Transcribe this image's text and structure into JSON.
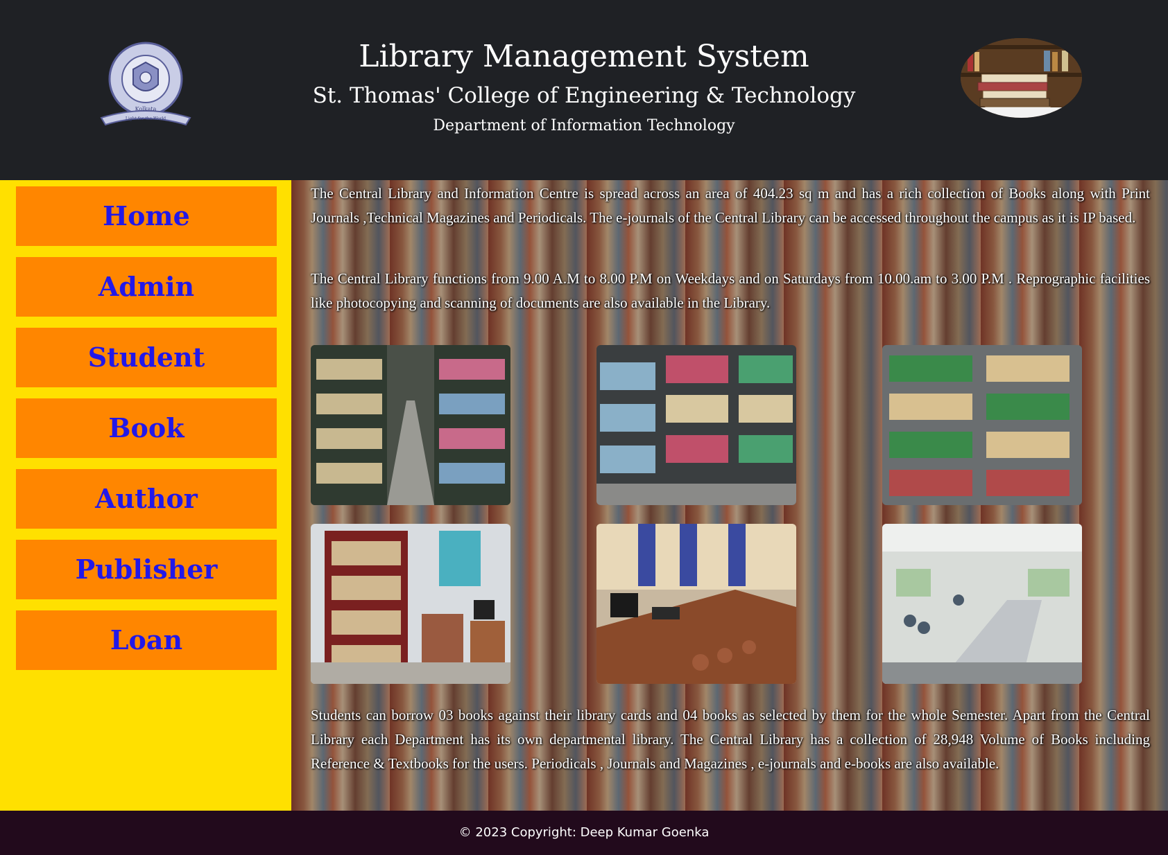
{
  "header": {
    "title": "Library Management System",
    "college": "St. Thomas' College of Engineering & Technology",
    "department": "Department of Information Technology",
    "logo_left_icon": "college-seal-icon",
    "logo_right_icon": "stacked-books-icon",
    "logo_seal_text": {
      "ring": "St. Thomas' College of Engineering & Technology",
      "city": "Kolkata",
      "motto": "Light for the World"
    }
  },
  "sidebar": {
    "items": [
      {
        "label": "Home"
      },
      {
        "label": "Admin"
      },
      {
        "label": "Student"
      },
      {
        "label": "Book"
      },
      {
        "label": "Author"
      },
      {
        "label": "Publisher"
      },
      {
        "label": "Loan"
      }
    ]
  },
  "main": {
    "paragraphs": [
      "The Central Library and Information Centre is spread across an area of 404.23 sq m and has a rich collection of Books along with Print Journals ,Technical Magazines and Periodicals. The e-journals of the Central Library can be accessed throughout the campus as it is IP based.",
      "The Central Library functions from 9.00 A.M to 8.00 P.M on Weekdays and on Saturdays from 10.00.am to 3.00 P.M . Reprographic facilities like photocopying and scanning of documents are also available in the Library.",
      "Students can borrow 03 books against their library cards and 04 books as selected by them for the whole Semester. Apart from the Central Library each Department has its own departmental library. The Central Library has a collection of 28,948 Volume of Books including Reference & Textbooks for the users. Periodicals , Journals and Magazines , e-journals and e-books are also available."
    ],
    "photos": [
      {
        "name": "library-aisle-photo"
      },
      {
        "name": "bookshelves-photo"
      },
      {
        "name": "green-bookshelves-photo"
      },
      {
        "name": "reading-corner-photo"
      },
      {
        "name": "computer-lab-photo"
      },
      {
        "name": "reading-hall-photo"
      }
    ]
  },
  "footer": {
    "copyright": "© 2023 Copyright: Deep Kumar Goenka"
  },
  "colors": {
    "header_bg": "#1f2125",
    "sidebar_bg": "#ffe000",
    "nav_button_bg": "#ff8600",
    "nav_button_text": "#2218e8",
    "footer_bg": "#220a1c"
  }
}
